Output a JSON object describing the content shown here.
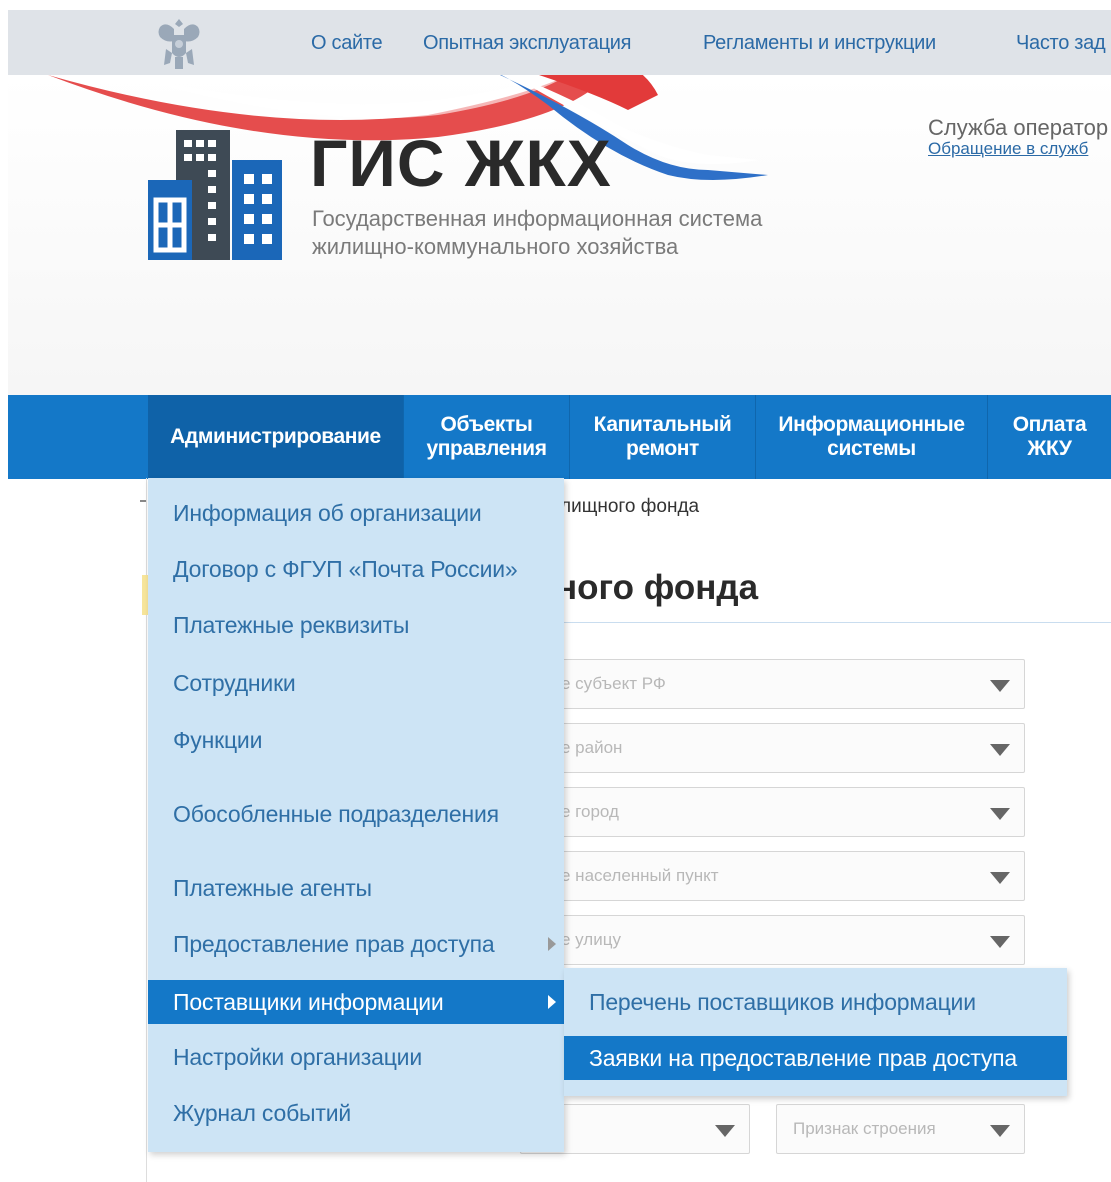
{
  "topnav": {
    "items": [
      {
        "label": "О сайте"
      },
      {
        "label": "Опытная эксплуатация"
      },
      {
        "label": "Регламенты и инструкции"
      },
      {
        "label": "Часто зад"
      }
    ]
  },
  "brand": {
    "title": "ГИС ЖКХ",
    "subtitle_line1": "Государственная информационная система",
    "subtitle_line2": "жилищно-коммунального хозяйства"
  },
  "support": {
    "title": "Служба оператор",
    "link": "Обращение в служб"
  },
  "mainnav": {
    "items": [
      {
        "line1": "Администрирование",
        "line2": ""
      },
      {
        "line1": "Объекты",
        "line2": "управления"
      },
      {
        "line1": "Капитальный",
        "line2": "ремонт"
      },
      {
        "line1": "Информационные",
        "line2": "системы"
      },
      {
        "line1": "Оплата",
        "line2": "ЖКУ"
      }
    ],
    "active_index": 0
  },
  "content": {
    "breadcrumb": "лищного фонда",
    "page_title": "ного фонда",
    "selects": [
      {
        "placeholder": "е субъект РФ"
      },
      {
        "placeholder": "е район"
      },
      {
        "placeholder": "е город"
      },
      {
        "placeholder": "е населенный пункт"
      },
      {
        "placeholder": "е улицу"
      },
      {
        "placeholder": ""
      },
      {
        "placeholder": "Признак строения"
      }
    ]
  },
  "dropdown": {
    "items": [
      {
        "label": "Информация об организации"
      },
      {
        "label": "Договор с ФГУП «Почта России»"
      },
      {
        "label": "Платежные реквизиты"
      },
      {
        "label": "Сотрудники"
      },
      {
        "label": "Функции"
      },
      {
        "label": "Обособленные подразделения"
      },
      {
        "label": "Платежные агенты"
      },
      {
        "label": "Предоставление прав доступа"
      },
      {
        "label": "Поставщики информации"
      },
      {
        "label": "Настройки организации"
      },
      {
        "label": "Журнал событий"
      }
    ],
    "highlighted": "Поставщики информации"
  },
  "submenu": {
    "items": [
      {
        "label": "Перечень поставщиков информации"
      },
      {
        "label": "Заявки на предоставление прав доступа"
      }
    ],
    "highlighted": "Заявки на предоставление прав доступа"
  },
  "colors": {
    "nav_blue": "#1478c8",
    "menu_bg": "#cde4f5",
    "link_blue": "#2b6aa6"
  }
}
